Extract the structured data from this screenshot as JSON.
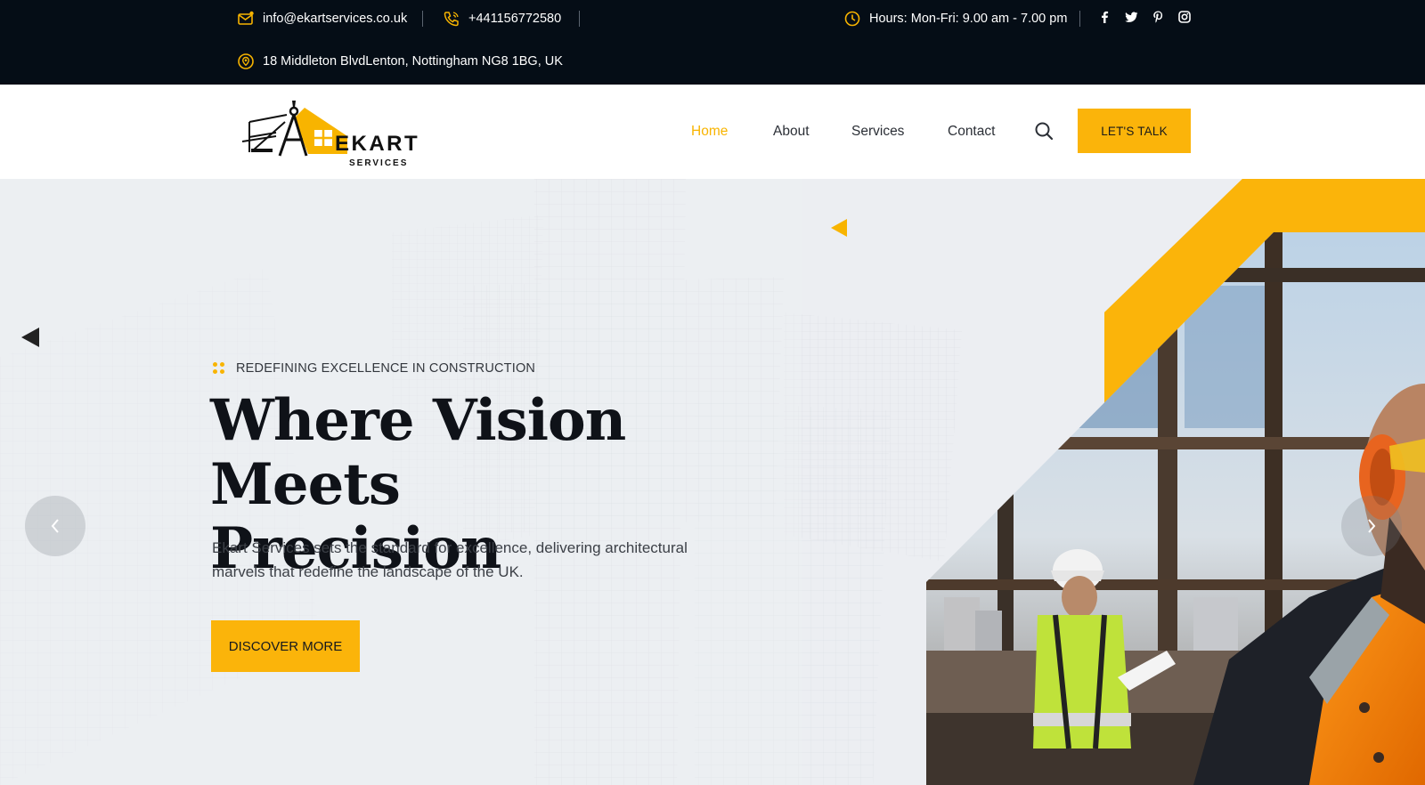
{
  "topbar": {
    "email": "info@ekartservices.co.uk",
    "phone": "+441156772580",
    "hours": "Hours: Mon-Fri: 9.00 am - 7.00 pm",
    "address": "18 Middleton BlvdLenton, Nottingham NG8 1BG, UK",
    "social": [
      "facebook-icon",
      "twitter-icon",
      "pinterest-icon",
      "instagram-icon"
    ]
  },
  "logo": {
    "main": "EKART",
    "sub": "SERVICES"
  },
  "nav": {
    "items": [
      "Home",
      "About",
      "Services",
      "Contact"
    ],
    "active": "Home",
    "cta": "LET'S TALK"
  },
  "hero": {
    "tagline": "REDEFINING EXCELLENCE IN CONSTRUCTION",
    "title_line1": "Where Vision Meets",
    "title_line2": "Precision",
    "description": "Ekart Services sets the standard for excellence, delivering architectural marvels that redefine the landscape of the UK.",
    "button": "DISCOVER MORE"
  },
  "colors": {
    "accent": "#fbb40a",
    "topbar": "#050d16",
    "text": "#0f1218"
  }
}
